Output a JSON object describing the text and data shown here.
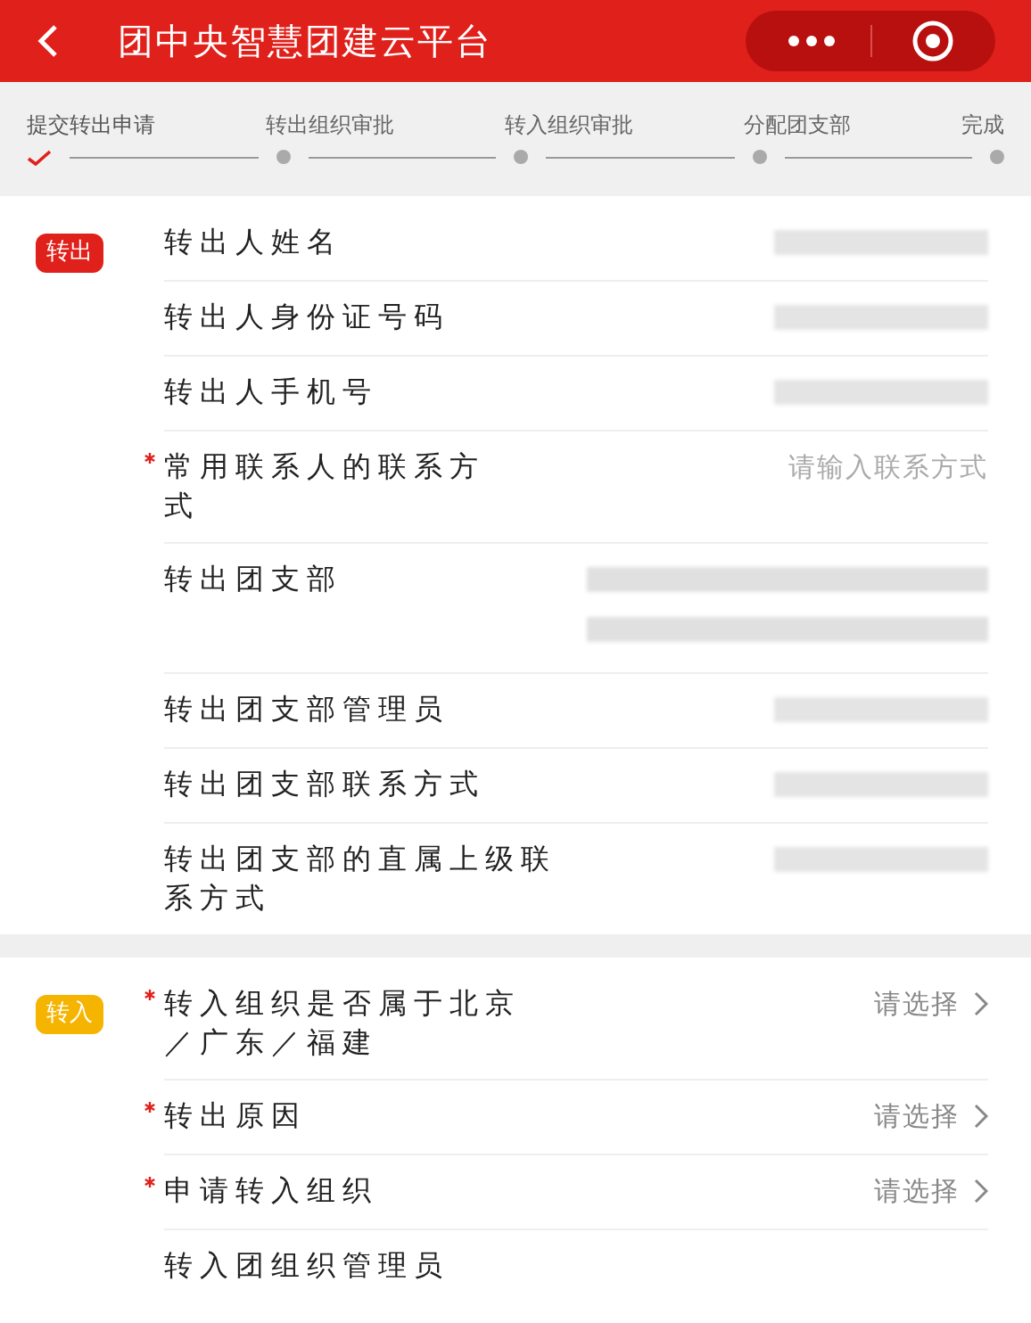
{
  "header": {
    "title": "团中央智慧团建云平台"
  },
  "steps": [
    {
      "label": "提交转出申请",
      "done": true
    },
    {
      "label": "转出组织审批",
      "done": false
    },
    {
      "label": "转入组织审批",
      "done": false
    },
    {
      "label": "分配团支部",
      "done": false
    },
    {
      "label": "完成",
      "done": false
    }
  ],
  "sections": [
    {
      "badge": "转出",
      "color": "#e0201a",
      "rows": [
        {
          "label": "转出人姓名",
          "required": false,
          "kind": "masked"
        },
        {
          "label": "转出人身份证号码",
          "required": false,
          "kind": "masked"
        },
        {
          "label": "转出人手机号",
          "required": false,
          "kind": "masked"
        },
        {
          "label": "常用联系人的联系方式",
          "required": true,
          "kind": "input",
          "placeholder": "请输入联系方式"
        },
        {
          "label": "转出团支部",
          "required": false,
          "kind": "masked_multiline"
        },
        {
          "label": "转出团支部管理员",
          "required": false,
          "kind": "masked"
        },
        {
          "label": "转出团支部联系方式",
          "required": false,
          "kind": "masked"
        },
        {
          "label": "转出团支部的直属上级联系方式",
          "required": false,
          "kind": "masked"
        }
      ]
    },
    {
      "badge": "转入",
      "color": "#f5b400",
      "rows": [
        {
          "label": "转入组织是否属于北京／广东／福建",
          "required": true,
          "kind": "select",
          "placeholder": "请选择"
        },
        {
          "label": "转出原因",
          "required": true,
          "kind": "select",
          "placeholder": "请选择"
        },
        {
          "label": "申请转入组织",
          "required": true,
          "kind": "select",
          "placeholder": "请选择"
        },
        {
          "label": "转入团组织管理员",
          "required": false,
          "kind": "masked_empty"
        }
      ]
    }
  ]
}
